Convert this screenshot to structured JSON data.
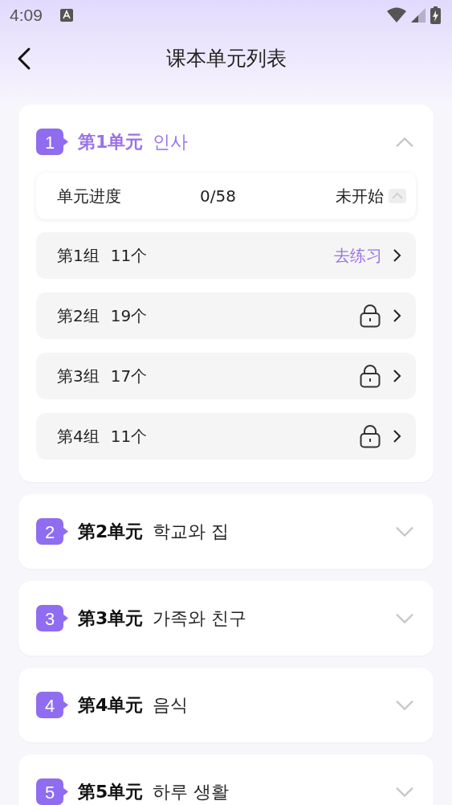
{
  "status_bar": {
    "time": "4:09"
  },
  "header": {
    "title": "课本单元列表"
  },
  "units": [
    {
      "number": "1",
      "title": "第1单元",
      "subtitle": "인사",
      "expanded": true,
      "progress": {
        "label": "单元进度",
        "value": "0/58",
        "status": "未开始"
      },
      "groups": [
        {
          "name": "第1组",
          "count": "11个",
          "kind": "practice",
          "action": "去练习"
        },
        {
          "name": "第2组",
          "count": "19个",
          "kind": "locked"
        },
        {
          "name": "第3组",
          "count": "17个",
          "kind": "locked"
        },
        {
          "name": "第4组",
          "count": "11个",
          "kind": "locked"
        }
      ]
    },
    {
      "number": "2",
      "title": "第2单元",
      "subtitle": "학교와 집",
      "expanded": false
    },
    {
      "number": "3",
      "title": "第3单元",
      "subtitle": "가족와 친구",
      "expanded": false
    },
    {
      "number": "4",
      "title": "第4单元",
      "subtitle": "음식",
      "expanded": false
    },
    {
      "number": "5",
      "title": "第5单元",
      "subtitle": "하루 생활",
      "expanded": false
    }
  ]
}
